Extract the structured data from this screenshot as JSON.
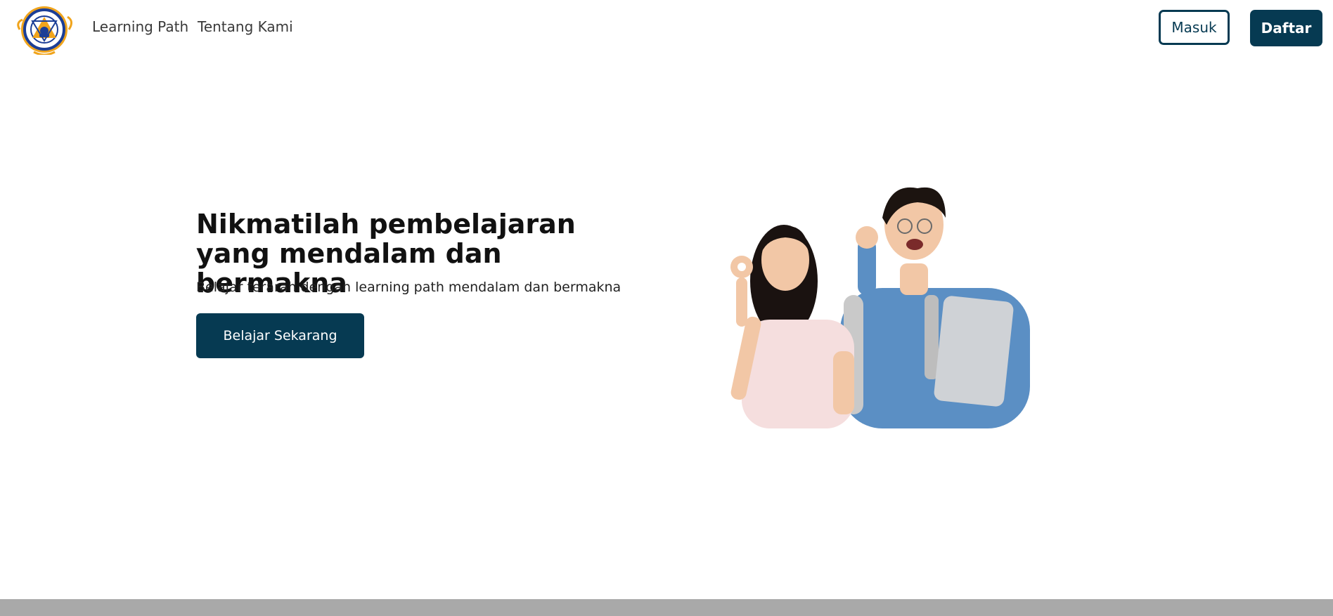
{
  "header": {
    "logo_icon": "organization-emblem-icon",
    "nav": [
      {
        "label": "Learning Path"
      },
      {
        "label": "Tentang Kami"
      }
    ],
    "login_label": "Masuk",
    "register_label": "Daftar"
  },
  "hero": {
    "title": "Nikmatilah pembelajaran yang mendalam dan bermakna",
    "subtitle": "Belajar terarah dengan learning path mendalam dan bermakna",
    "cta_label": "Belajar Sekarang",
    "illustration": "two-students-photo"
  },
  "colors": {
    "primary": "#063a52",
    "footer": "#a9a9a9",
    "logo_ring": "#f0a41c",
    "logo_inner": "#1b3e96"
  }
}
